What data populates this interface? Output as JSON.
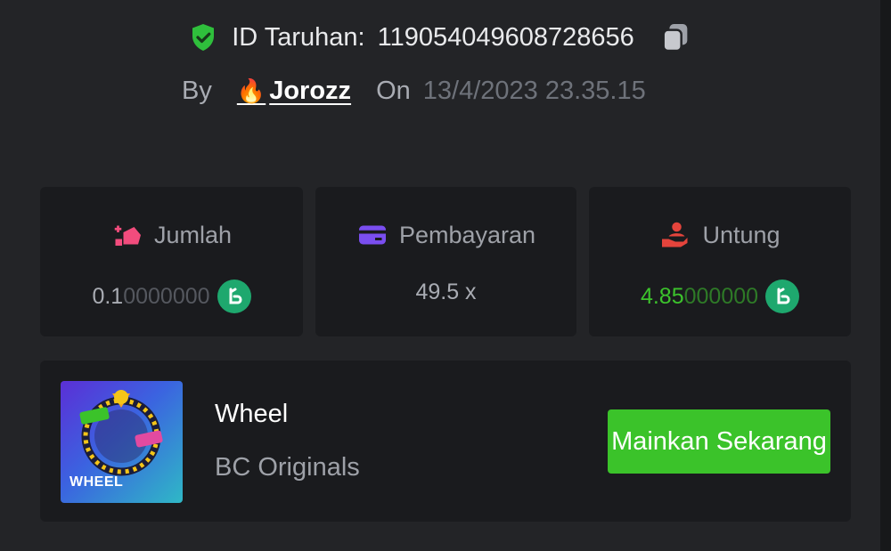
{
  "header": {
    "bet_id_label": "ID Taruhan:",
    "bet_id_value": "119054049608728656",
    "by_label": "By",
    "user_name": "Jorozz",
    "user_emoji": "🔥",
    "on_label": "On",
    "date": "13/4/2023 23.35.15"
  },
  "stats": {
    "amount": {
      "label": "Jumlah",
      "value_main": "0.1",
      "value_dim": "0000000",
      "icon": "money-bag-icon"
    },
    "payout": {
      "label": "Pembayaran",
      "value": "49.5 x",
      "icon": "card-icon"
    },
    "profit": {
      "label": "Untung",
      "value_main": "4.85",
      "value_dim": "000000",
      "icon": "profit-hand-icon"
    }
  },
  "game": {
    "thumb_label": "WHEEL",
    "name": "Wheel",
    "provider": "BC Originals",
    "play_label": "Mainkan Sekarang"
  },
  "colors": {
    "accent_green": "#3bc32a",
    "shield_green": "#2fbf3c",
    "coin_green": "#1ea86e",
    "pink": "#f24c7d",
    "purple": "#7a4ef0",
    "red": "#e5443c"
  }
}
